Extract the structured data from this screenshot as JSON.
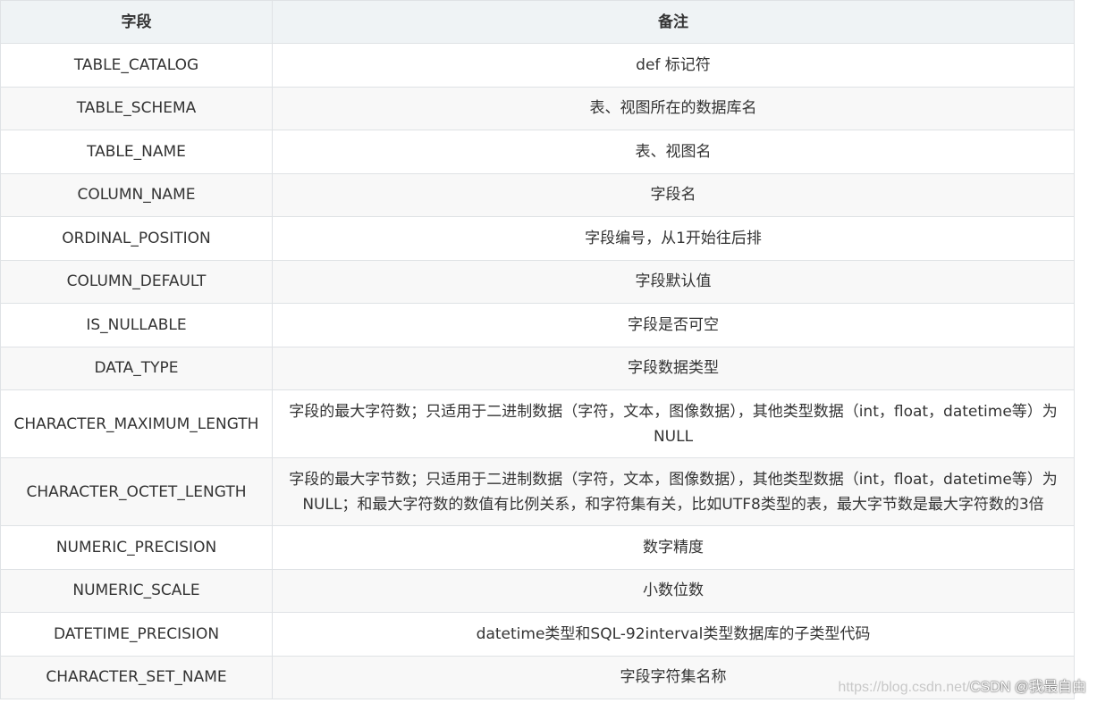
{
  "table": {
    "headers": [
      "字段",
      "备注"
    ],
    "rows": [
      {
        "field": "TABLE_CATALOG",
        "note": "def 标记符"
      },
      {
        "field": "TABLE_SCHEMA",
        "note": "表、视图所在的数据库名"
      },
      {
        "field": "TABLE_NAME",
        "note": "表、视图名"
      },
      {
        "field": "COLUMN_NAME",
        "note": "字段名"
      },
      {
        "field": "ORDINAL_POSITION",
        "note": "字段编号，从1开始往后排"
      },
      {
        "field": "COLUMN_DEFAULT",
        "note": "字段默认值"
      },
      {
        "field": "IS_NULLABLE",
        "note": "字段是否可空"
      },
      {
        "field": "DATA_TYPE",
        "note": "字段数据类型"
      },
      {
        "field": "CHARACTER_MAXIMUM_LENGTH",
        "note": "字段的最大字符数；只适用于二进制数据（字符，文本，图像数据），其他类型数据（int，float，datetime等）为NULL"
      },
      {
        "field": "CHARACTER_OCTET_LENGTH",
        "note": "字段的最大字节数；只适用于二进制数据（字符，文本，图像数据），其他类型数据（int，float，datetime等）为NULL；和最大字符数的数值有比例关系，和字符集有关，比如UTF8类型的表，最大字节数是最大字符数的3倍"
      },
      {
        "field": "NUMERIC_PRECISION",
        "note": "数字精度"
      },
      {
        "field": "NUMERIC_SCALE",
        "note": "小数位数"
      },
      {
        "field": "DATETIME_PRECISION",
        "note": "datetime类型和SQL-92interval类型数据库的子类型代码"
      },
      {
        "field": "CHARACTER_SET_NAME",
        "note": "字段字符集名称"
      }
    ]
  },
  "watermark": {
    "url": "https://blog.csdn.net/",
    "author": "CSDN @我最自由"
  }
}
